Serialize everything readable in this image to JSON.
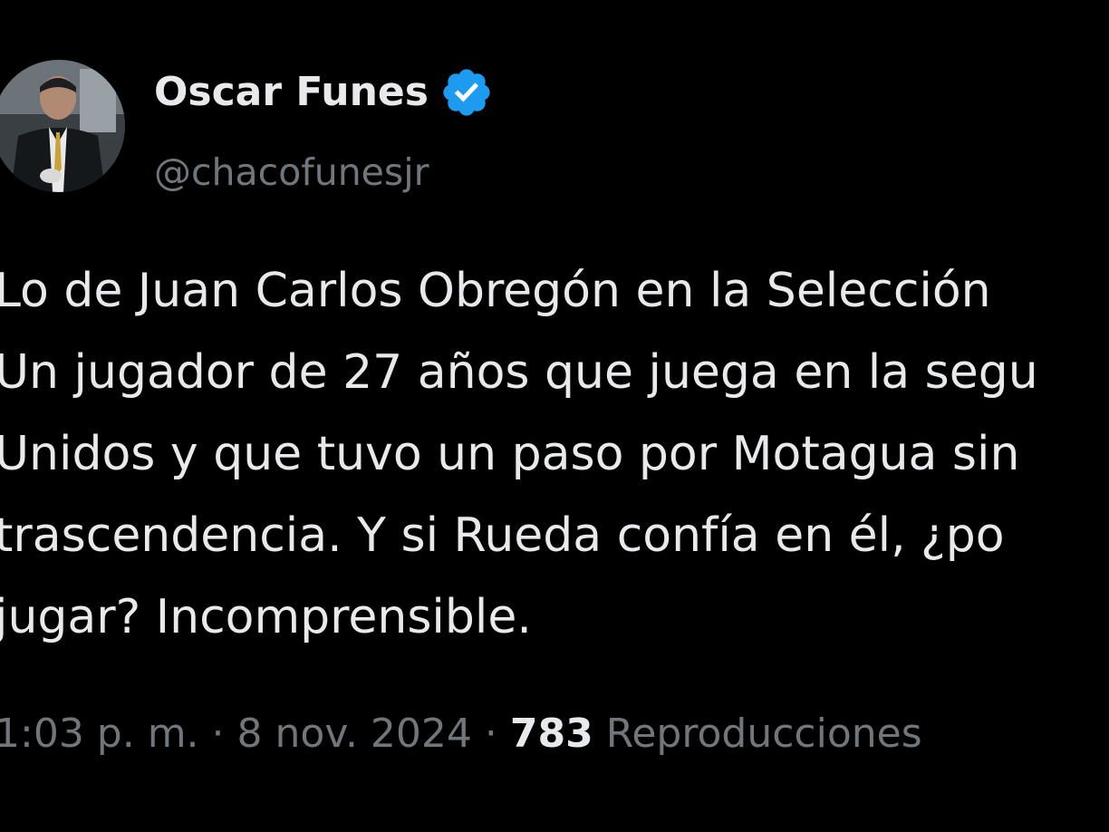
{
  "author": {
    "display_name": "Oscar Funes",
    "handle": "@chacofunesjr",
    "verified": true,
    "verified_color": "#1d9bf0",
    "avatar_icon": "profile-photo"
  },
  "tweet": {
    "lines": [
      "Lo de Juan Carlos Obregón en la Selección",
      "Un jugador de 27 años que juega en la segu",
      "Unidos y que tuvo un paso por Motagua sin",
      "trascendencia. Y si Rueda confía en él, ¿po",
      "jugar? Incomprensible."
    ]
  },
  "meta": {
    "time": "1:03 p. m.",
    "separator": "·",
    "date": "8 nov. 2024",
    "views_count": "783",
    "views_label": "Reproducciones"
  },
  "colors": {
    "background": "#000000",
    "primary_text": "#e7e9ea",
    "secondary_text": "#71767b",
    "accent": "#1d9bf0"
  }
}
